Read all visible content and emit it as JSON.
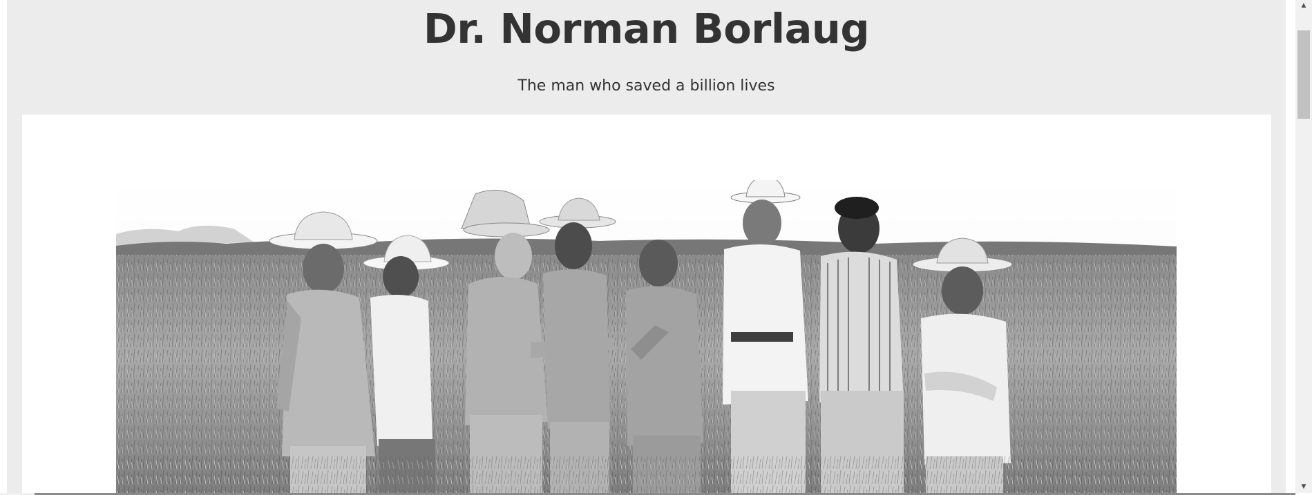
{
  "header": {
    "title": "Dr. Norman Borlaug",
    "subtitle": "The man who saved a billion lives"
  },
  "image": {
    "alt": "Dr. Norman Borlaug with a group of men in a wheat field",
    "style": "black-and-white"
  },
  "scrollbar": {
    "up_glyph": "▲",
    "down_glyph": "▼"
  },
  "icons": {
    "scroll_up": "triangle-up-icon",
    "scroll_down": "triangle-down-icon"
  },
  "colors": {
    "page_background": "#ececec",
    "text": "#333333",
    "image_frame": "#ffffff"
  }
}
